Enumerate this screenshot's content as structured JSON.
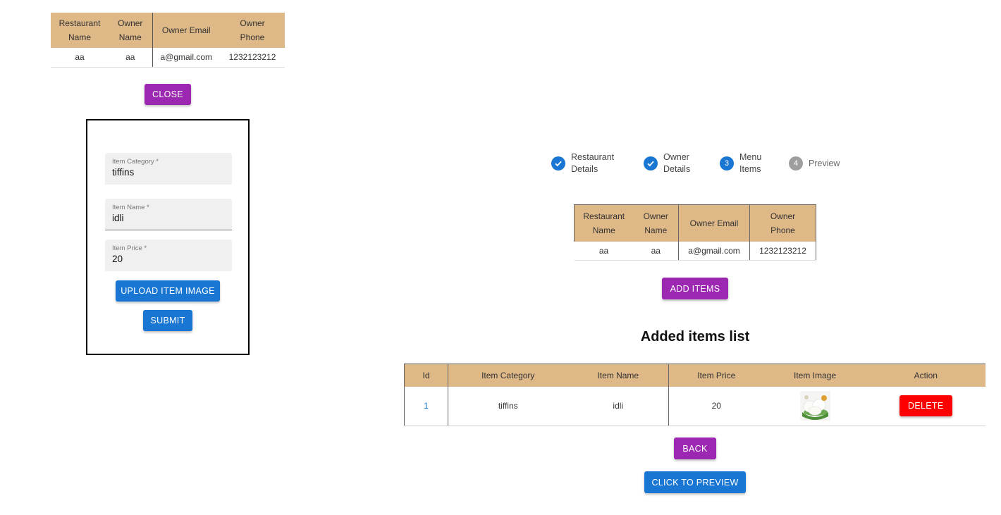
{
  "owner_table": {
    "headers": [
      "Restaurant Name",
      "Owner Name",
      "Owner Email",
      "Owner Phone"
    ],
    "row": [
      "aa",
      "aa",
      "a@gmail.com",
      "1232123212"
    ]
  },
  "close_label": "CLOSE",
  "form": {
    "category_label": "Item Category *",
    "category_value": "tiffins",
    "name_label": "Item Name *",
    "name_value": "idli",
    "price_label": "Item Price *",
    "price_value": "20",
    "upload_label": "UPLOAD ITEM IMAGE",
    "submit_label": "SUBMIT"
  },
  "stepper": [
    {
      "label": "Restaurant Details",
      "state": "done",
      "icon": "check-icon"
    },
    {
      "label": "Owner Details",
      "state": "done",
      "icon": "check-icon"
    },
    {
      "label": "Menu Items",
      "state": "active",
      "number": "3"
    },
    {
      "label": "Preview",
      "state": "pending",
      "number": "4"
    }
  ],
  "add_items_label": "ADD ITEMS",
  "list_title": "Added items list",
  "items_table": {
    "headers": [
      "Id",
      "Item Category",
      "Item Name",
      "Item Price",
      "Item Image",
      "Action"
    ],
    "rows": [
      {
        "id": "1",
        "category": "tiffins",
        "name": "idli",
        "price": "20",
        "image": "idli-image",
        "action": "DELETE"
      }
    ]
  },
  "back_label": "BACK",
  "preview_label": "CLICK TO PREVIEW",
  "colors": {
    "header_bg": "#deb887",
    "purple": "#9c27b0",
    "blue": "#1976d2",
    "red": "#ff0000",
    "pending": "#9e9e9e"
  }
}
